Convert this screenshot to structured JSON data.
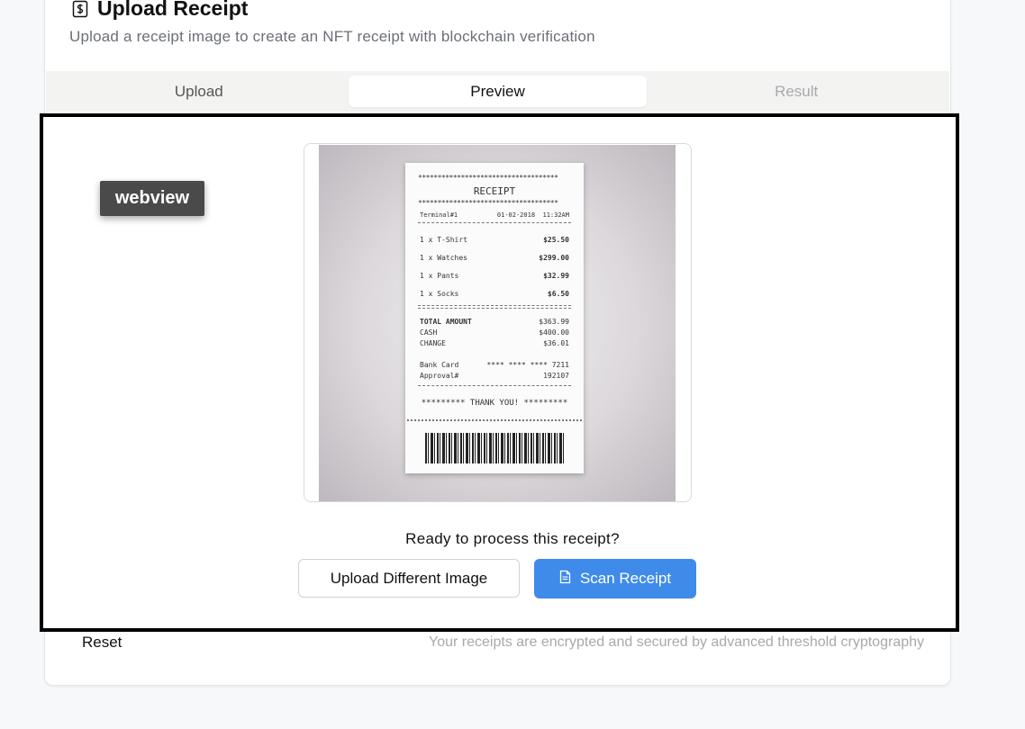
{
  "header": {
    "title": "Upload Receipt",
    "subtitle": "Upload a receipt image to create an NFT receipt with blockchain verification",
    "icon": "receipt-dollar-icon"
  },
  "tabs": [
    {
      "label": "Upload",
      "state": "normal"
    },
    {
      "label": "Preview",
      "state": "active"
    },
    {
      "label": "Result",
      "state": "disabled"
    }
  ],
  "overlay": {
    "label": "webview"
  },
  "receipt": {
    "heading": "RECEIPT",
    "terminal": "Terminal#1",
    "date": "01-02-2018",
    "time": "11:32AM",
    "items": [
      {
        "name": "1 x T-Shirt",
        "price": "$25.50"
      },
      {
        "name": "1 x Watches",
        "price": "$299.00"
      },
      {
        "name": "1 x Pants",
        "price": "$32.99"
      },
      {
        "name": "1 x Socks",
        "price": "$6.50"
      }
    ],
    "total_label": "TOTAL AMOUNT",
    "total_value": "$363.99",
    "cash_label": "CASH",
    "cash_value": "$400.00",
    "change_label": "CHANGE",
    "change_value": "$36.01",
    "card_label": "Bank Card",
    "card_value": "**** **** **** 7211",
    "approval_label": "Approval#",
    "approval_value": "192107",
    "thanks": "********* THANK YOU! *********",
    "stars": "************************************"
  },
  "prompt": "Ready to process this receipt?",
  "buttons": {
    "upload_different": "Upload Different Image",
    "scan": "Scan Receipt",
    "scan_icon": "document-icon"
  },
  "footer": {
    "reset": "Reset",
    "note": "Your receipts are encrypted and secured by advanced threshold cryptography"
  },
  "colors": {
    "primary": "#3f8bea",
    "tab_bg": "#f3f3f1",
    "muted_text": "#a6a9ad"
  }
}
